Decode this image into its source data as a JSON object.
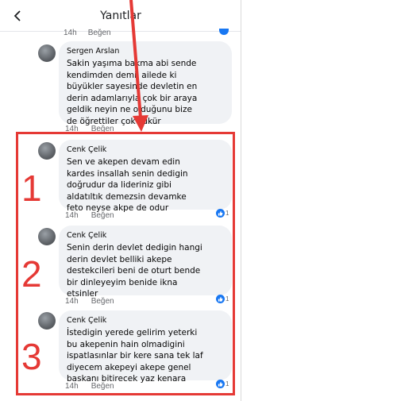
{
  "header": {
    "title": "Yanıtlar"
  },
  "top_meta": {
    "time": "14h",
    "like": "Beğen"
  },
  "comments": [
    {
      "author": "Sergen Arslan",
      "text": "Sakin yaşıma bakma abi sende\nkendimden demil ailede ki\nbüyükler sayesinde devletin en\nderin adamlarıyla çok bir araya\ngeldik neyin ne olduğunu bize\nde öğrettiler çok şükür",
      "time": "14h",
      "like": "Beğen"
    },
    {
      "author": "Cenk Çelik",
      "text": "Sen ve akepen devam edin\nkardes insallah senin dedigin\ndoğrudur da lideriniz gibi\naldatıltık demezsin devamke\nfeto neyse akpe de odur",
      "time": "14h",
      "like": "Beğen",
      "reactions": "1"
    },
    {
      "author": "Cenk Çelik",
      "text": "Senin derin devlet dedigin hangi\nderin devlet belliki akepe\ndestekcileri beni de oturt bende\nbir dinleyeyim benide ikna\netsinler",
      "time": "14h",
      "like": "Beğen",
      "reactions": "1"
    },
    {
      "author": "Cenk Çelik",
      "text": "İstedigin yerede gelirim yeterki\nbu akepenin hain olmadigini\nispatlasınlar bir kere sana tek laf\ndiyecem akepeyi akepe genel\nbaskanı bitirecek yaz kenara",
      "time": "14h",
      "like": "Beğen",
      "reactions": "1"
    }
  ],
  "annotations": {
    "num1": "1",
    "num2": "2",
    "num3": "3"
  },
  "colors": {
    "annotation": "#e53935",
    "bubble": "#f0f2f5",
    "like_blue": "#1877f2"
  },
  "icons": {
    "back": "chevron-left-icon",
    "reaction": "thumbs-up-icon"
  }
}
